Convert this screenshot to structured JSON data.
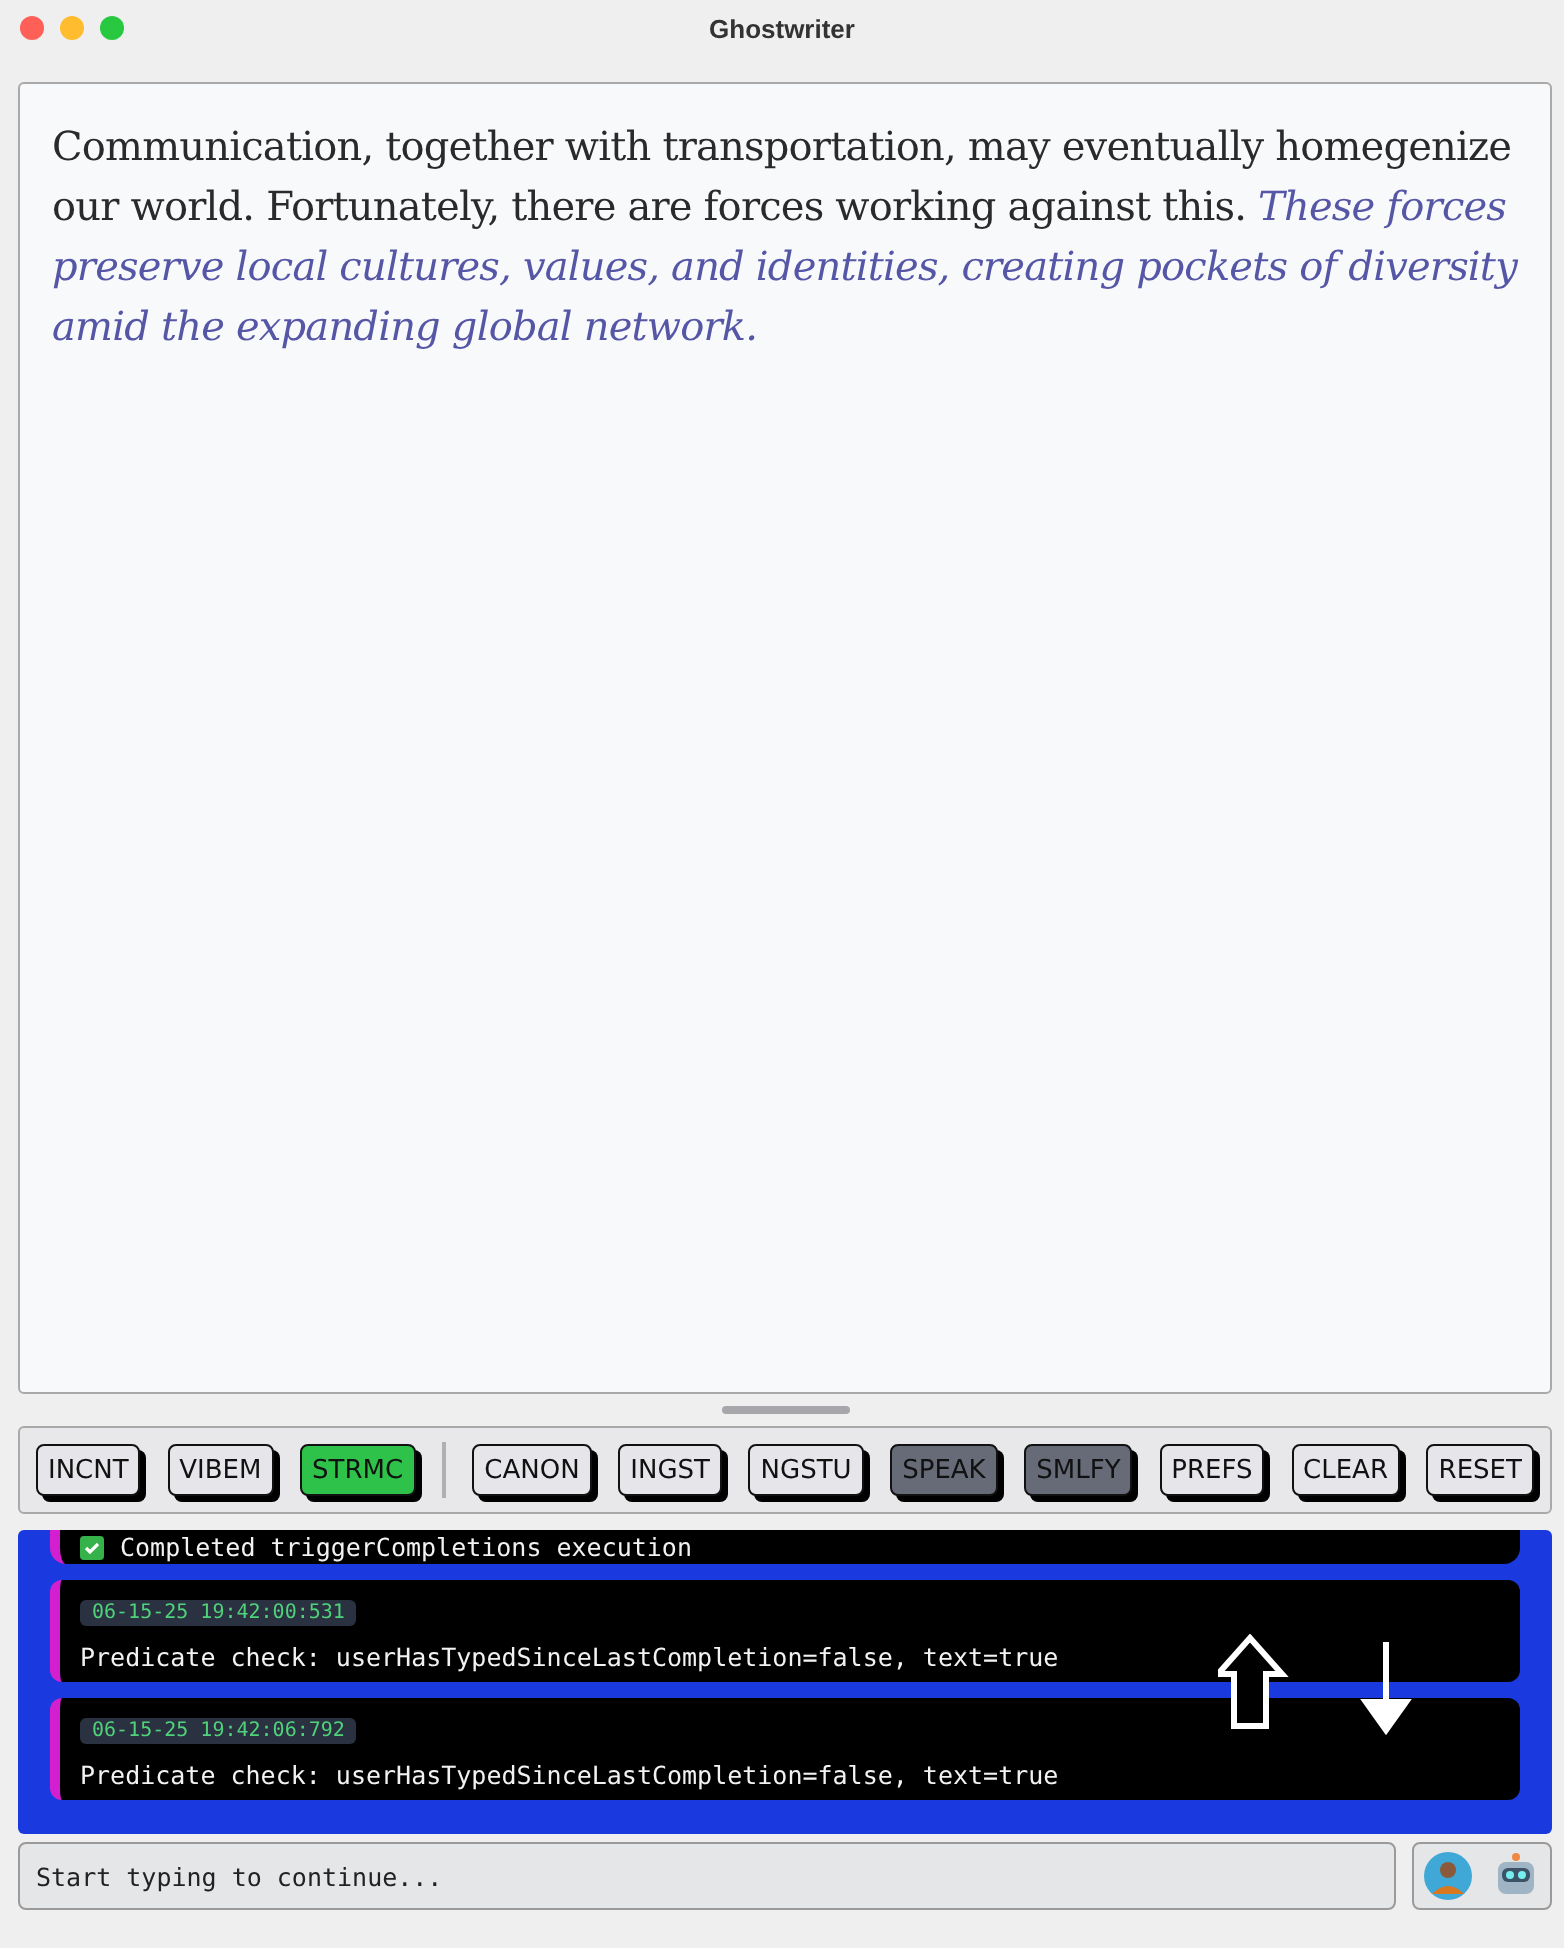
{
  "window": {
    "title": "Ghostwriter"
  },
  "editor": {
    "text": "Communication, together with transportation, may eventually homegenize our world. Fortunately, there are forces working against this.",
    "suggestion": "These forces preserve local cultures, values, and identities, creating pockets of diversity amid the expanding global network."
  },
  "toolbar": [
    {
      "label": "INCNT",
      "active": false,
      "disabled": false
    },
    {
      "label": "VIBEM",
      "active": false,
      "disabled": false
    },
    {
      "label": "STRMC",
      "active": true,
      "disabled": false
    },
    {
      "label": "CANON",
      "active": false,
      "disabled": false
    },
    {
      "label": "INGST",
      "active": false,
      "disabled": false
    },
    {
      "label": "NGSTU",
      "active": false,
      "disabled": false
    },
    {
      "label": "SPEAK",
      "active": false,
      "disabled": true
    },
    {
      "label": "SMLFY",
      "active": false,
      "disabled": true
    },
    {
      "label": "PREFS",
      "active": false,
      "disabled": false
    },
    {
      "label": "CLEAR",
      "active": false,
      "disabled": false
    },
    {
      "label": "RESET",
      "active": false,
      "disabled": false
    }
  ],
  "log": [
    {
      "kind": "status",
      "message": "Completed triggerCompletions execution"
    },
    {
      "kind": "entry",
      "timestamp": "06-15-25 19:42:00:531",
      "message": "Predicate check: userHasTypedSinceLastCompletion=false, text=true"
    },
    {
      "kind": "entry",
      "timestamp": "06-15-25 19:42:06:792",
      "message": "Predicate check: userHasTypedSinceLastCompletion=false, text=true"
    }
  ],
  "input": {
    "placeholder": "Start typing to continue..."
  }
}
